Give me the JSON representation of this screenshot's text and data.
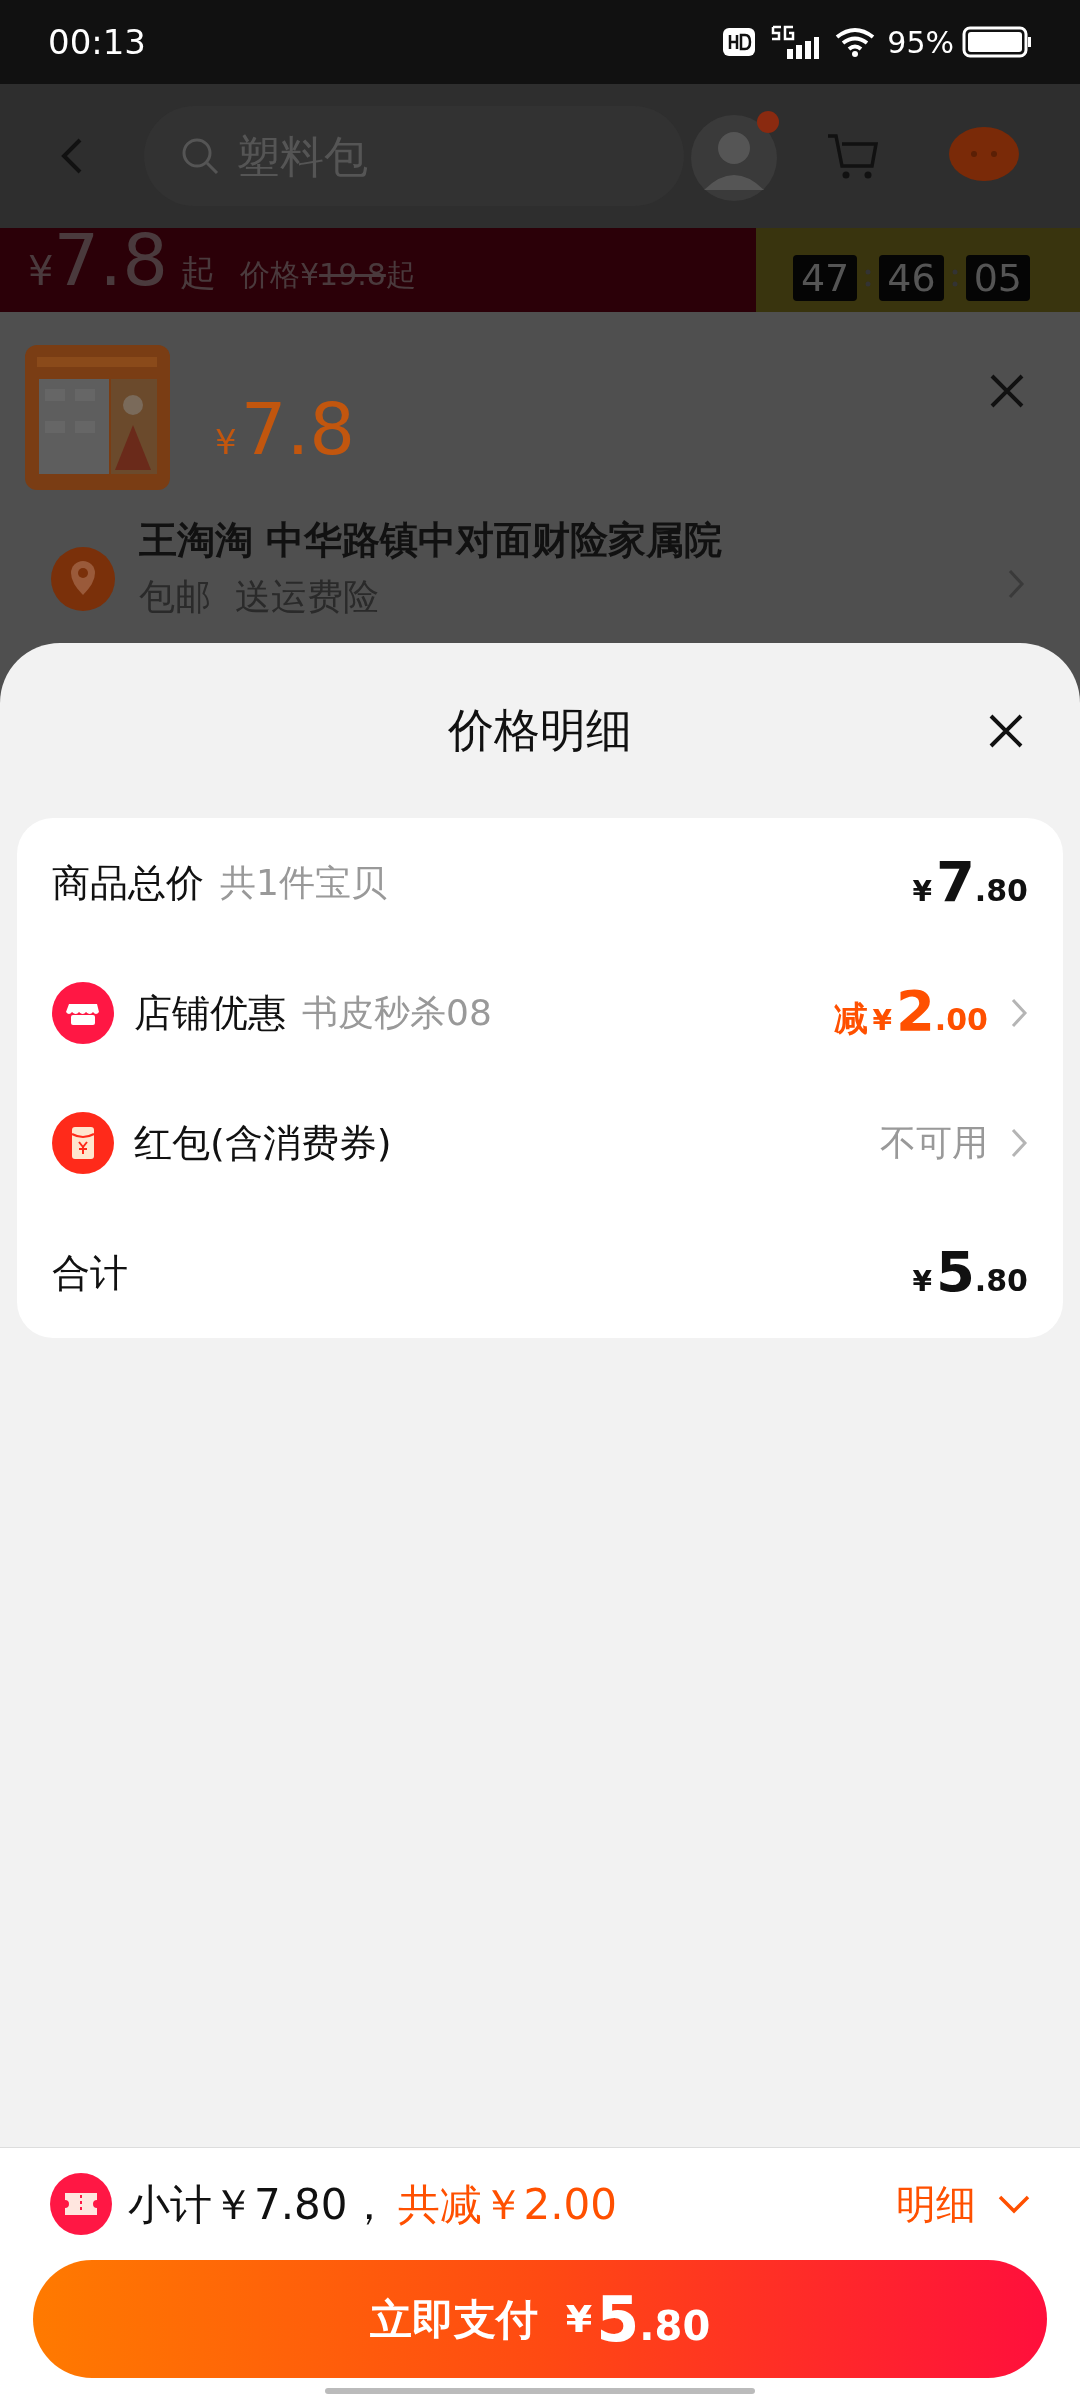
{
  "status_bar": {
    "time": "00:13",
    "battery": "95%"
  },
  "header": {
    "search": {
      "placeholder": "塑料包"
    }
  },
  "banner": {
    "price_symbol": "¥",
    "price": "7.8",
    "price_suffix": "起",
    "original_label": "价格",
    "original_symbol": "¥",
    "original_price": "19.8",
    "original_suffix": "起",
    "countdown": [
      "47",
      "46",
      "05"
    ]
  },
  "product": {
    "price_symbol": "¥",
    "price": "7.8",
    "address": "王淘淘 中华路镇中对面财险家属院",
    "services": [
      "包邮",
      "送运费险"
    ]
  },
  "sheet": {
    "title": "价格明细",
    "rows": [
      {
        "kind": "amount",
        "label": "商品总价",
        "note": "共1件宝贝",
        "symbol": "¥",
        "amount_int": "7",
        "amount_dec": ".80",
        "chevron": false
      },
      {
        "kind": "discount",
        "label": "店铺优惠",
        "note": "书皮秒杀08",
        "prefix": "减",
        "symbol": "¥",
        "amount_int": "2",
        "amount_dec": ".00",
        "chevron": true
      },
      {
        "kind": "status",
        "label": "红包(含消费券)",
        "status": "不可用",
        "chevron": true
      },
      {
        "kind": "amount",
        "label": "合计",
        "symbol": "¥",
        "amount_int": "5",
        "amount_dec": ".80",
        "chevron": false
      }
    ]
  },
  "footer": {
    "subtotal": "小计￥7.80，",
    "discount": "共减￥2.00",
    "details": "明细",
    "pay_button": {
      "label": "立即支付",
      "symbol": "¥",
      "amount_int": "5",
      "amount_dec": ".80"
    }
  }
}
